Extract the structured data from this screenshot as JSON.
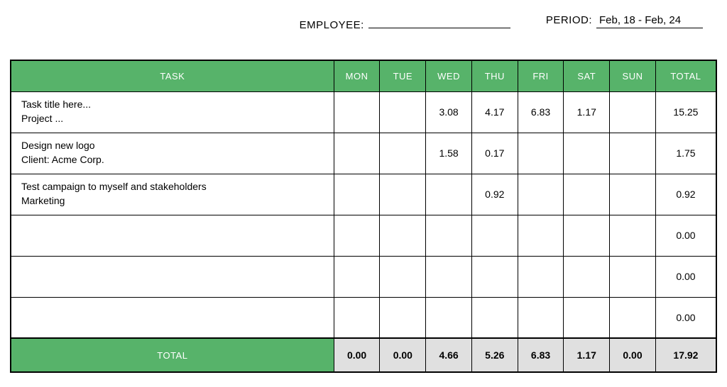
{
  "header": {
    "employee_label": "EMPLOYEE:",
    "employee_value": "",
    "period_label": "PERIOD:",
    "period_value": "Feb, 18 - Feb, 24"
  },
  "columns": {
    "task": "TASK",
    "mon": "MON",
    "tue": "TUE",
    "wed": "WED",
    "thu": "THU",
    "fri": "FRI",
    "sat": "SAT",
    "sun": "SUN",
    "total": "TOTAL"
  },
  "rows": [
    {
      "task_title": "Task title here...",
      "task_sub": "Project ...",
      "mon": "",
      "tue": "",
      "wed": "3.08",
      "thu": "4.17",
      "fri": "6.83",
      "sat": "1.17",
      "sun": "",
      "total": "15.25"
    },
    {
      "task_title": "Design new logo",
      "task_sub": "Client: Acme Corp.",
      "mon": "",
      "tue": "",
      "wed": "1.58",
      "thu": "0.17",
      "fri": "",
      "sat": "",
      "sun": "",
      "total": "1.75"
    },
    {
      "task_title": "Test campaign to myself and stakeholders",
      "task_sub": "Marketing",
      "mon": "",
      "tue": "",
      "wed": "",
      "thu": "0.92",
      "fri": "",
      "sat": "",
      "sun": "",
      "total": "0.92"
    },
    {
      "task_title": "",
      "task_sub": "",
      "mon": "",
      "tue": "",
      "wed": "",
      "thu": "",
      "fri": "",
      "sat": "",
      "sun": "",
      "total": "0.00"
    },
    {
      "task_title": "",
      "task_sub": "",
      "mon": "",
      "tue": "",
      "wed": "",
      "thu": "",
      "fri": "",
      "sat": "",
      "sun": "",
      "total": "0.00"
    },
    {
      "task_title": "",
      "task_sub": "",
      "mon": "",
      "tue": "",
      "wed": "",
      "thu": "",
      "fri": "",
      "sat": "",
      "sun": "",
      "total": "0.00"
    }
  ],
  "totals": {
    "label": "TOTAL",
    "mon": "0.00",
    "tue": "0.00",
    "wed": "4.66",
    "thu": "5.26",
    "fri": "6.83",
    "sat": "1.17",
    "sun": "0.00",
    "grand": "17.92"
  }
}
